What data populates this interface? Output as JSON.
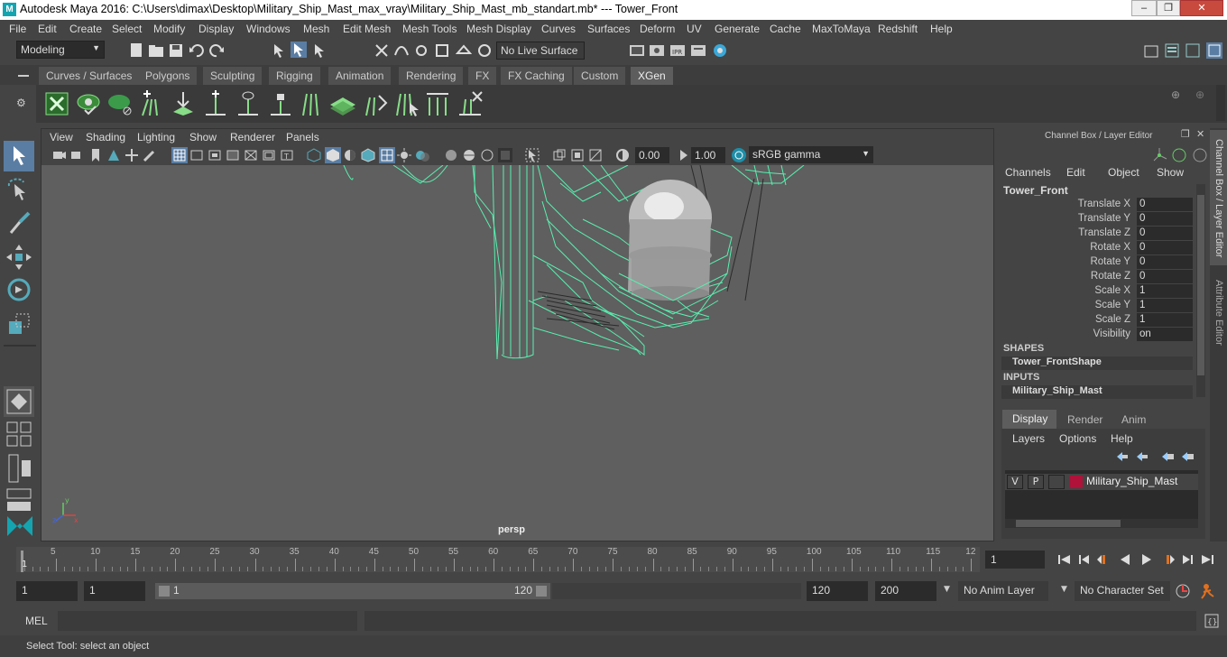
{
  "titlebar": {
    "title": "Autodesk Maya 2016: C:\\Users\\dimax\\Desktop\\Military_Ship_Mast_max_vray\\Military_Ship_Mast_mb_standart.mb*   ---   Tower_Front",
    "minimize": "–",
    "restore": "❐",
    "close": "✕"
  },
  "menu": [
    "File",
    "Edit",
    "Create",
    "Select",
    "Modify",
    "Display",
    "Windows",
    "Mesh",
    "Edit Mesh",
    "Mesh Tools",
    "Mesh Display",
    "Curves",
    "Surfaces",
    "Deform",
    "UV",
    "Generate",
    "Cache",
    "MaxToMaya",
    "Redshift",
    "Help"
  ],
  "status": {
    "mode": "Modeling",
    "live_surface": "No Live Surface"
  },
  "shelf_tabs": [
    "Curves / Surfaces",
    "Polygons",
    "Sculpting",
    "Rigging",
    "Animation",
    "Rendering",
    "FX",
    "FX Caching",
    "Custom",
    "XGen"
  ],
  "active_shelf_tab": "XGen",
  "viewport": {
    "menu": [
      "View",
      "Shading",
      "Lighting",
      "Show",
      "Renderer",
      "Panels"
    ],
    "exposure": "0.00",
    "gamma": "1.00",
    "color_space": "sRGB gamma",
    "camera_label": "persp"
  },
  "channel_box": {
    "header": "Channel Box / Layer Editor",
    "menu": [
      "Channels",
      "Edit",
      "Object",
      "Show"
    ],
    "object_name": "Tower_Front",
    "attributes": [
      {
        "name": "Translate X",
        "value": "0"
      },
      {
        "name": "Translate Y",
        "value": "0"
      },
      {
        "name": "Translate Z",
        "value": "0"
      },
      {
        "name": "Rotate X",
        "value": "0"
      },
      {
        "name": "Rotate Y",
        "value": "0"
      },
      {
        "name": "Rotate Z",
        "value": "0"
      },
      {
        "name": "Scale X",
        "value": "1"
      },
      {
        "name": "Scale Y",
        "value": "1"
      },
      {
        "name": "Scale Z",
        "value": "1"
      },
      {
        "name": "Visibility",
        "value": "on"
      }
    ],
    "shapes_label": "SHAPES",
    "shape_name": "Tower_FrontShape",
    "inputs_label": "INPUTS",
    "input_name": "Military_Ship_Mast"
  },
  "layer_editor": {
    "tabs": [
      "Display",
      "Render",
      "Anim"
    ],
    "active_tab": "Display",
    "menu": [
      "Layers",
      "Options",
      "Help"
    ],
    "layer": {
      "v": "V",
      "p": "P",
      "name": "Military_Ship_Mast",
      "color": "#b0123a"
    }
  },
  "side_tabs": [
    "Channel Box / Layer Editor",
    "Attribute Editor"
  ],
  "timeline": {
    "ticks": [
      "5",
      "10",
      "15",
      "20",
      "25",
      "30",
      "35",
      "40",
      "45",
      "50",
      "55",
      "60",
      "65",
      "70",
      "75",
      "80",
      "85",
      "90",
      "95",
      "100",
      "105",
      "110",
      "115",
      "12"
    ],
    "start_marker": "1",
    "current_frame": "1"
  },
  "range": {
    "start": "1",
    "anim_start": "1",
    "slider_start": "1",
    "slider_end": "120",
    "end": "120",
    "anim_end": "200",
    "anim_layer": "No Anim Layer",
    "char_set": "No Character Set"
  },
  "mel": {
    "label": "MEL"
  },
  "help_line": "Select Tool: select an object",
  "colors": {
    "wire": "#57f0b0",
    "accent": "#14a4b0",
    "layer": "#b0123a"
  }
}
